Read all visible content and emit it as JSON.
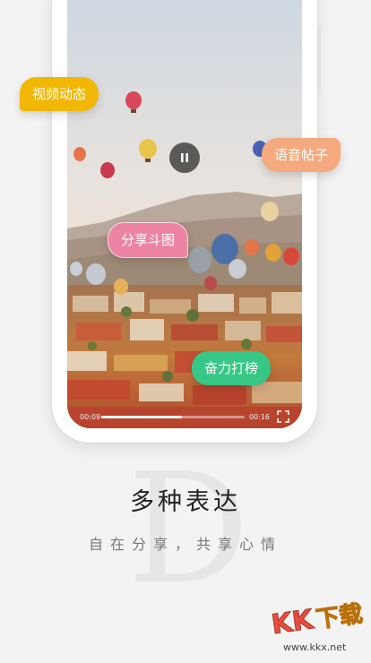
{
  "tags": {
    "video_dynamic": "视频动态",
    "voice_post": "语音帖子",
    "meme_share": "分享斗图",
    "rank_hit": "奋力打榜"
  },
  "player": {
    "current_time": "00:09",
    "total_time": "00:16",
    "progress": 0.56,
    "pause_icon": "pause-icon",
    "fullscreen_icon": "fullscreen-icon"
  },
  "feature": {
    "title": "多种表达",
    "subtitle": "自在分享，共享心情",
    "bg_letter": "D"
  },
  "watermark": {
    "brand": "KK下载",
    "url": "www.kkx.net"
  },
  "colors": {
    "video_tag": "#f2b705",
    "voice_tag": "#f4a97f",
    "meme_tag": "#ee84a5",
    "rank_tag": "#37c786",
    "watermark_red": "#e74c3c"
  }
}
